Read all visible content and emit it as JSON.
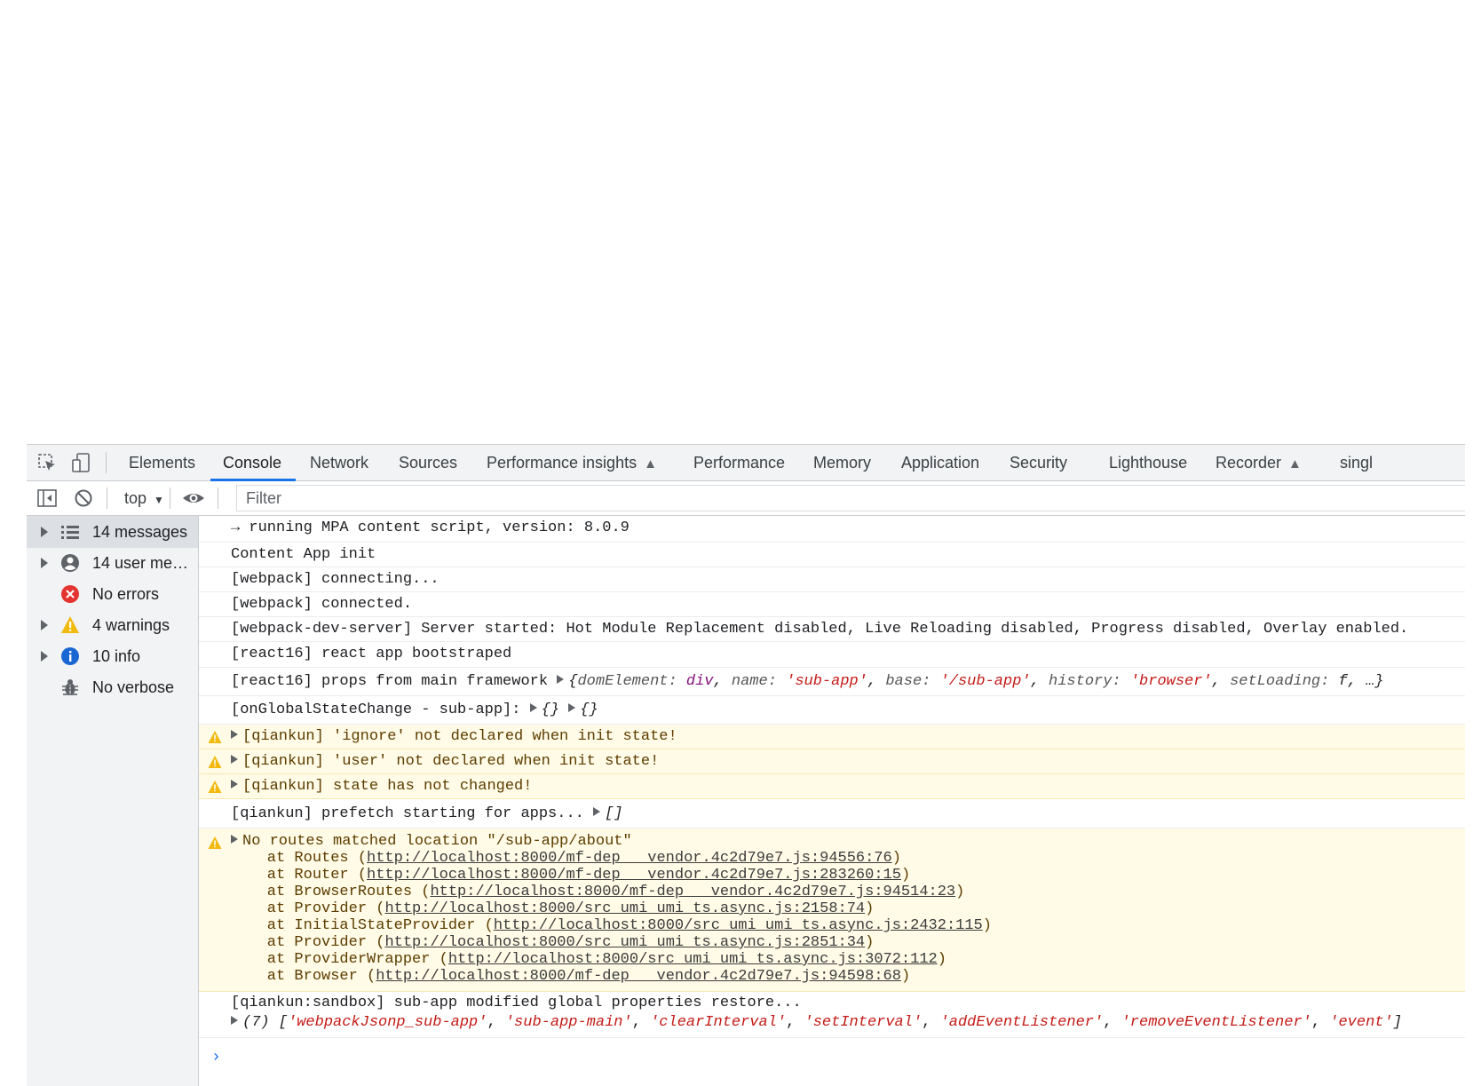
{
  "tabs": [
    "Elements",
    "Console",
    "Network",
    "Sources",
    "Performance insights",
    "Performance",
    "Memory",
    "Application",
    "Security",
    "Lighthouse",
    "Recorder",
    "singl"
  ],
  "active_tab": "Console",
  "toolbar": {
    "context": "top",
    "filter_placeholder": "Filter"
  },
  "sidebar": {
    "items": [
      {
        "label": "14 messages",
        "icon": "list-icon"
      },
      {
        "label": "14 user me…",
        "icon": "user-icon"
      },
      {
        "label": "No errors",
        "icon": "error-icon"
      },
      {
        "label": "4 warnings",
        "icon": "warning-icon"
      },
      {
        "label": "10 info",
        "icon": "info-icon"
      },
      {
        "label": "No verbose",
        "icon": "bug-icon"
      }
    ]
  },
  "messages": {
    "m0": "→ running MPA content script, version: 8.0.9",
    "m1": "Content App init",
    "m2": "[webpack] connecting...",
    "m3": "[webpack] connected.",
    "m4": "[webpack-dev-server] Server started: Hot Module Replacement disabled, Live Reloading disabled, Progress disabled, Overlay enabled.",
    "m5": "[react16] react app bootstraped",
    "m6": {
      "prefix": "[react16] props from main framework ",
      "obj_open": "{",
      "k1": "domElement: ",
      "v1": "div",
      "k2": "name: ",
      "v2": "'sub-app'",
      "k3": "base: ",
      "v3": "'/sub-app'",
      "k4": "history: ",
      "v4": "'browser'",
      "k5": "setLoading: ",
      "v5": "f",
      "tail": ", …}"
    },
    "m7": {
      "prefix": "[onGlobalStateChange - sub-app]: ",
      "o1": "{}",
      "o2": "{}"
    },
    "w1": "[qiankun] 'ignore' not declared when init state!",
    "w2": "[qiankun] 'user' not declared when init state!",
    "w3": "[qiankun] state has not changed!",
    "m8": {
      "prefix": "[qiankun] prefetch starting for apps... ",
      "arr": "[]"
    },
    "w4": {
      "head": "No routes matched location \"/sub-app/about\"",
      "stack": [
        {
          "pre": "    at Routes (",
          "link": "http://localhost:8000/mf-dep___vendor.4c2d79e7.js:94556:76",
          "post": ")"
        },
        {
          "pre": "    at Router (",
          "link": "http://localhost:8000/mf-dep___vendor.4c2d79e7.js:283260:15",
          "post": ")"
        },
        {
          "pre": "    at BrowserRoutes (",
          "link": "http://localhost:8000/mf-dep___vendor.4c2d79e7.js:94514:23",
          "post": ")"
        },
        {
          "pre": "    at Provider (",
          "link": "http://localhost:8000/src_umi_umi_ts.async.js:2158:74",
          "post": ")"
        },
        {
          "pre": "    at InitialStateProvider (",
          "link": "http://localhost:8000/src_umi_umi_ts.async.js:2432:115",
          "post": ")"
        },
        {
          "pre": "    at Provider (",
          "link": "http://localhost:8000/src_umi_umi_ts.async.js:2851:34",
          "post": ")"
        },
        {
          "pre": "    at ProviderWrapper (",
          "link": "http://localhost:8000/src_umi_umi_ts.async.js:3072:112",
          "post": ")"
        },
        {
          "pre": "    at Browser (",
          "link": "http://localhost:8000/mf-dep___vendor.4c2d79e7.js:94598:68",
          "post": ")"
        }
      ]
    },
    "m9": {
      "line1": "[qiankun:sandbox] sub-app modified global properties restore...",
      "count": "(7) [",
      "items": [
        "'webpackJsonp_sub-app'",
        "'sub-app-main'",
        "'clearInterval'",
        "'setInterval'",
        "'addEventListener'",
        "'removeEventListener'",
        "'event'"
      ],
      "sep": ", ",
      "close": "]"
    },
    "prompt": "›"
  }
}
